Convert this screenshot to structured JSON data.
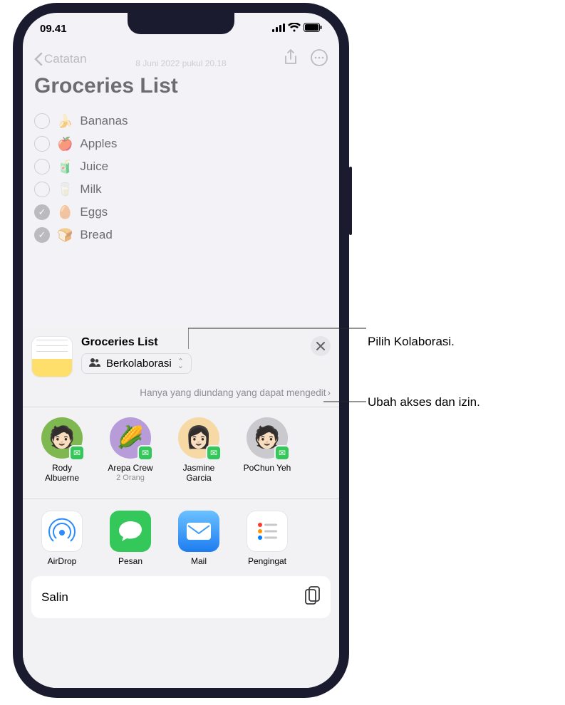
{
  "status": {
    "time": "09.41"
  },
  "nav": {
    "back": "Catatan"
  },
  "note": {
    "date": "8 Juni 2022 pukul 20.18",
    "title": "Groceries List",
    "items": [
      {
        "emoji": "🍌",
        "label": "Bananas",
        "checked": false
      },
      {
        "emoji": "🍎",
        "label": "Apples",
        "checked": false
      },
      {
        "emoji": "🧃",
        "label": "Juice",
        "checked": false
      },
      {
        "emoji": "🥛",
        "label": "Milk",
        "checked": false
      },
      {
        "emoji": "🥚",
        "label": "Eggs",
        "checked": true
      },
      {
        "emoji": "🍞",
        "label": "Bread",
        "checked": true
      }
    ]
  },
  "sheet": {
    "title": "Groceries List",
    "collaborate": "Berkolaborasi",
    "access_text": "Hanya yang diundang yang dapat mengedit",
    "copy_action": "Salin"
  },
  "contacts": [
    {
      "name": "Rody Albuerne",
      "sub": "",
      "avatar_bg": "#7fb851",
      "emoji": "🧑🏻"
    },
    {
      "name": "Arepa Crew",
      "sub": "2 Orang",
      "avatar_bg": "#b89bd9",
      "emoji": "🌽"
    },
    {
      "name": "Jasmine Garcia",
      "sub": "",
      "avatar_bg": "#f7d9a6",
      "emoji": "👩🏻"
    },
    {
      "name": "PoChun Yeh",
      "sub": "",
      "avatar_bg": "#c9c9ce",
      "emoji": "🧑🏻"
    }
  ],
  "apps": [
    {
      "name": "AirDrop"
    },
    {
      "name": "Pesan"
    },
    {
      "name": "Mail"
    },
    {
      "name": "Pengingat"
    }
  ],
  "callouts": {
    "collab": "Pilih Kolaborasi.",
    "access": "Ubah akses dan izin."
  }
}
